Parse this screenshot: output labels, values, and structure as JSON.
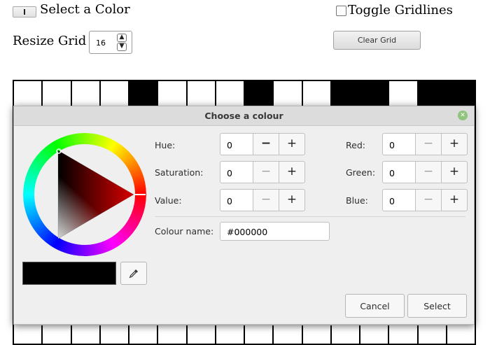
{
  "page": {
    "select_color_label": "Select a Color",
    "toggle_gridlines_label": "Toggle Gridlines",
    "toggle_gridlines_checked": false,
    "resize_grid_label": "Resize Grid",
    "grid_size_value": "16",
    "clear_grid_label": "Clear Grid"
  },
  "grid": {
    "top_row": [
      0,
      0,
      0,
      0,
      1,
      0,
      0,
      0,
      1,
      0,
      0,
      1,
      1,
      0,
      1,
      1
    ],
    "bottom_row": [
      0,
      0,
      0,
      0,
      0,
      0,
      0,
      0,
      0,
      0,
      0,
      0,
      0,
      0,
      0,
      0
    ]
  },
  "dialog": {
    "title": "Choose a colour",
    "hue": {
      "label": "Hue:",
      "value": "0"
    },
    "saturation": {
      "label": "Saturation:",
      "value": "0"
    },
    "value": {
      "label": "Value:",
      "value": "0"
    },
    "red": {
      "label": "Red:",
      "value": "0"
    },
    "green": {
      "label": "Green:",
      "value": "0"
    },
    "blue": {
      "label": "Blue:",
      "value": "0"
    },
    "colour_name": {
      "label": "Colour name:",
      "value": "#000000"
    },
    "minus_symbol": "−",
    "plus_symbol": "+",
    "cancel_label": "Cancel",
    "select_label": "Select",
    "preview_color": "#000000",
    "close_icon": "close-icon"
  },
  "colors": {
    "dialog_bg": "#efefef",
    "titlebar_bg": "#dcdcdc",
    "close_green": "#8ec47b",
    "grid_line": "#000000"
  }
}
